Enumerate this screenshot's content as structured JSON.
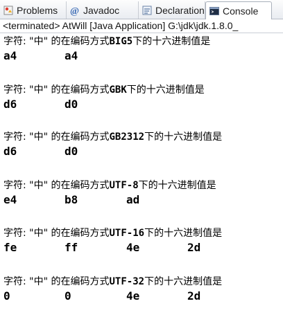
{
  "tabs": [
    {
      "label": "Problems",
      "icon": "problems-icon",
      "active": false
    },
    {
      "label": "Javadoc",
      "icon": "javadoc-icon",
      "active": false
    },
    {
      "label": "Declaration",
      "icon": "declaration-icon",
      "active": false
    },
    {
      "label": "Console",
      "icon": "console-icon",
      "active": true
    }
  ],
  "status": "<terminated> AtWill [Java Application] G:\\jdk\\jdk.1.8.0_",
  "blocks": [
    {
      "prefix": "字符: \"中\" 的在编码方式",
      "encoding": "BIG5",
      "suffix": "下的十六进制值是",
      "hex": [
        "a4",
        "a4"
      ]
    },
    {
      "prefix": "字符: \"中\" 的在编码方式",
      "encoding": "GBK",
      "suffix": "下的十六进制值是",
      "hex": [
        "d6",
        "d0"
      ]
    },
    {
      "prefix": "字符: \"中\" 的在编码方式",
      "encoding": "GB2312",
      "suffix": "下的十六进制值是",
      "hex": [
        "d6",
        "d0"
      ]
    },
    {
      "prefix": "字符: \"中\" 的在编码方式",
      "encoding": "UTF-8",
      "suffix": "下的十六进制值是",
      "hex": [
        "e4",
        "b8",
        "ad"
      ]
    },
    {
      "prefix": "字符: \"中\" 的在编码方式",
      "encoding": "UTF-16",
      "suffix": "下的十六进制值是",
      "hex": [
        "fe",
        "ff",
        "4e",
        "2d"
      ]
    },
    {
      "prefix": "字符: \"中\" 的在编码方式",
      "encoding": "UTF-32",
      "suffix": "下的十六进制值是",
      "hex": [
        "0",
        "0",
        "4e",
        "2d"
      ]
    }
  ]
}
